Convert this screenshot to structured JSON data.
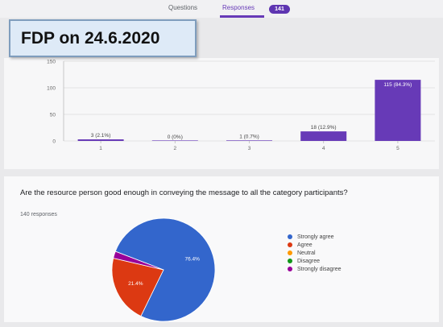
{
  "tabs": {
    "questions_label": "Questions",
    "responses_label": "Responses",
    "responses_count": "141"
  },
  "banner": {
    "title": "FDP on 24.6.2020"
  },
  "bar_chart": {
    "y_ticks": [
      "0",
      "50",
      "100",
      "150"
    ],
    "x_ticks": [
      "1",
      "2",
      "3",
      "4",
      "5"
    ]
  },
  "pie_section": {
    "question": "Are the resource person good enough in conveying the message to all the category participants?",
    "responses_text": "140 responses",
    "legend": [
      {
        "label": "Strongly agree",
        "color": "#3366cc"
      },
      {
        "label": "Agree",
        "color": "#dc3912"
      },
      {
        "label": "Neutral",
        "color": "#ff9900"
      },
      {
        "label": "Disagree",
        "color": "#109618"
      },
      {
        "label": "Strongly disagree",
        "color": "#990099"
      }
    ]
  },
  "chart_data": [
    {
      "type": "bar",
      "categories": [
        "1",
        "2",
        "3",
        "4",
        "5"
      ],
      "values": [
        3,
        0,
        1,
        18,
        115
      ],
      "data_labels": [
        "3 (2.1%)",
        "0 (0%)",
        "1 (0.7%)",
        "18 (12.9%)",
        "115 (84.3%)"
      ],
      "ylim": [
        0,
        150
      ],
      "color": "#673ab7",
      "grid": true
    },
    {
      "type": "pie",
      "categories": [
        "Strongly agree",
        "Agree",
        "Neutral",
        "Disagree",
        "Strongly disagree"
      ],
      "values": [
        76.4,
        21.4,
        0,
        0,
        2.2
      ],
      "data_labels": [
        "76.4%",
        "21.4%",
        "",
        "",
        ""
      ],
      "colors": [
        "#3366cc",
        "#dc3912",
        "#ff9900",
        "#109618",
        "#990099"
      ],
      "legend_position": "right"
    }
  ]
}
